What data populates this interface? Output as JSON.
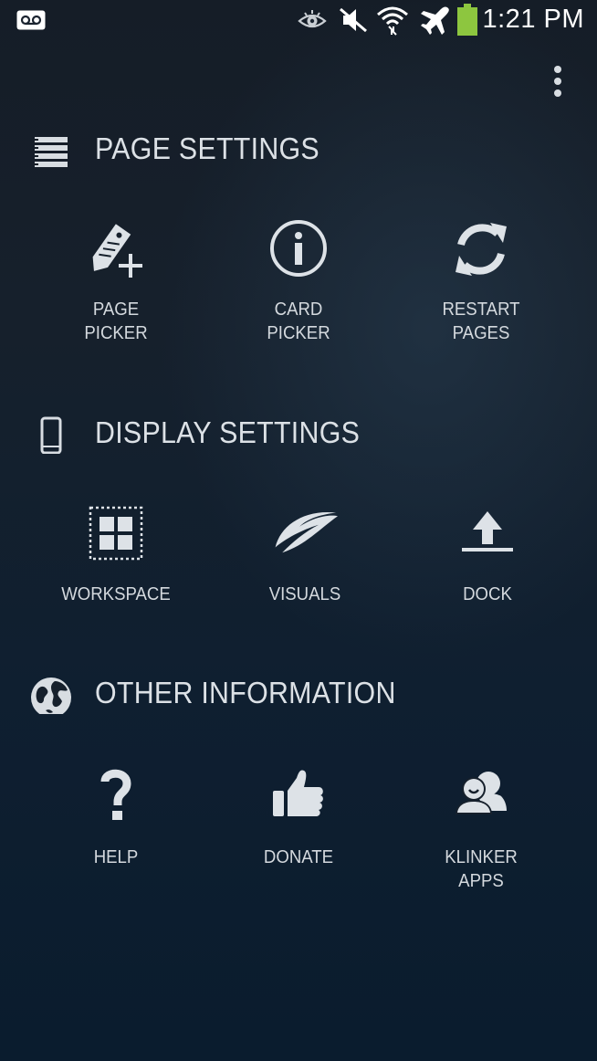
{
  "status_bar": {
    "time": "1:21 PM",
    "icons": [
      "voicemail-icon",
      "eye-icon",
      "mute-icon",
      "wifi-icon",
      "airplane-mode-icon",
      "battery-icon"
    ],
    "battery_color": "#8dc63f"
  },
  "menu": {
    "icon": "overflow-menu-icon"
  },
  "sections": [
    {
      "title": "PAGE SETTINGS",
      "icon": "list-icon",
      "items": [
        {
          "label": "PAGE\nPICKER",
          "icon": "tag-add-icon"
        },
        {
          "label": "CARD\nPICKER",
          "icon": "info-icon"
        },
        {
          "label": "RESTART\nPAGES",
          "icon": "refresh-icon"
        }
      ]
    },
    {
      "title": "DISPLAY SETTINGS",
      "icon": "phone-icon",
      "items": [
        {
          "label": "WORKSPACE",
          "icon": "workspace-grid-icon"
        },
        {
          "label": "VISUALS",
          "icon": "swoosh-icon"
        },
        {
          "label": "DOCK",
          "icon": "upload-dock-icon"
        }
      ]
    },
    {
      "title": "OTHER INFORMATION",
      "icon": "globe-icon",
      "items": [
        {
          "label": "HELP",
          "icon": "question-icon"
        },
        {
          "label": "DONATE",
          "icon": "thumbs-up-icon"
        },
        {
          "label": "KLINKER\nAPPS",
          "icon": "people-icon"
        }
      ]
    }
  ],
  "colors": {
    "background_top": "#151d27",
    "background_bottom": "#0a1c2e",
    "text": "#d8dde2",
    "icon": "#dde2e7"
  }
}
